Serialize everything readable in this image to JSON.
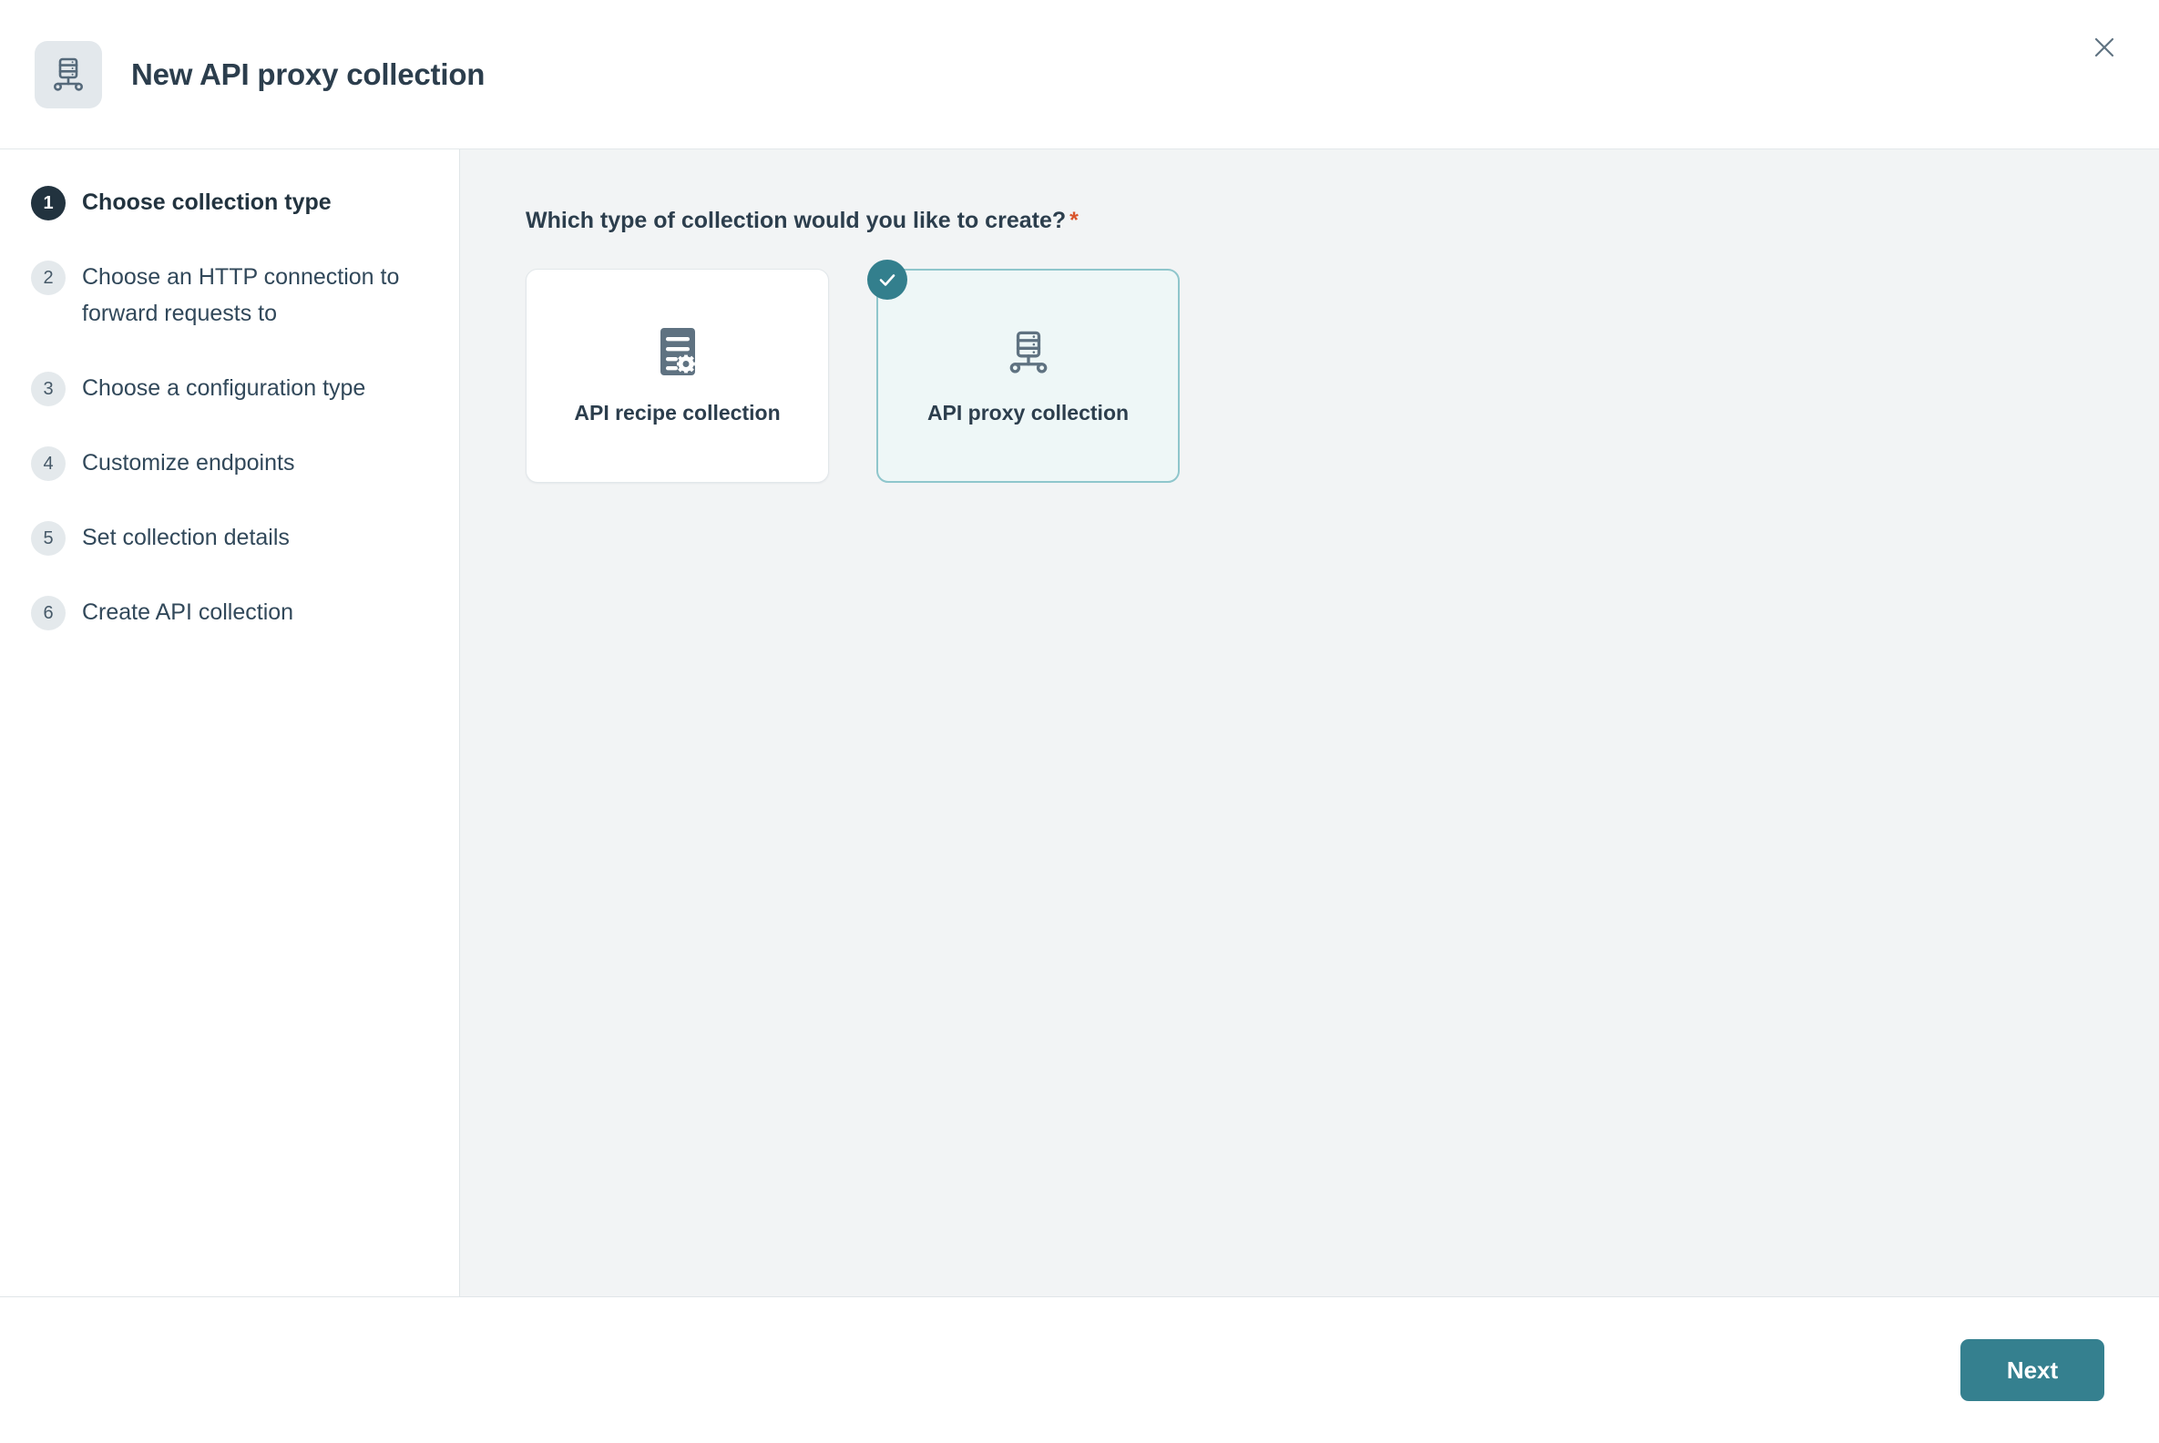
{
  "header": {
    "title": "New API proxy collection",
    "icon": "api-proxy-collection-icon",
    "close_icon": "close-icon"
  },
  "sidebar": {
    "steps": [
      {
        "number": "1",
        "label": "Choose collection type",
        "active": true
      },
      {
        "number": "2",
        "label": "Choose an HTTP connection to forward requests to",
        "active": false
      },
      {
        "number": "3",
        "label": "Choose a configuration type",
        "active": false
      },
      {
        "number": "4",
        "label": "Customize endpoints",
        "active": false
      },
      {
        "number": "5",
        "label": "Set collection details",
        "active": false
      },
      {
        "number": "6",
        "label": "Create API collection",
        "active": false
      }
    ]
  },
  "main": {
    "question": "Which type of collection would you like to create?",
    "required_marker": "*",
    "options": [
      {
        "label": "API recipe collection",
        "icon": "api-recipe-collection-icon",
        "selected": false
      },
      {
        "label": "API proxy collection",
        "icon": "api-proxy-collection-icon",
        "selected": true,
        "check_icon": "check-icon"
      }
    ]
  },
  "footer": {
    "next_label": "Next"
  },
  "colors": {
    "accent_teal": "#35808f",
    "selected_card_border": "#8fc6cc",
    "selected_card_bg": "#eef7f7",
    "check_badge": "#337f8d",
    "text_dark": "#2c3e4d",
    "icon_slate": "#5f7281",
    "required_star": "#d9542b",
    "main_bg": "#f2f4f5",
    "step_badge_inactive": "#e4e9ec",
    "step_badge_active": "#22333f"
  }
}
